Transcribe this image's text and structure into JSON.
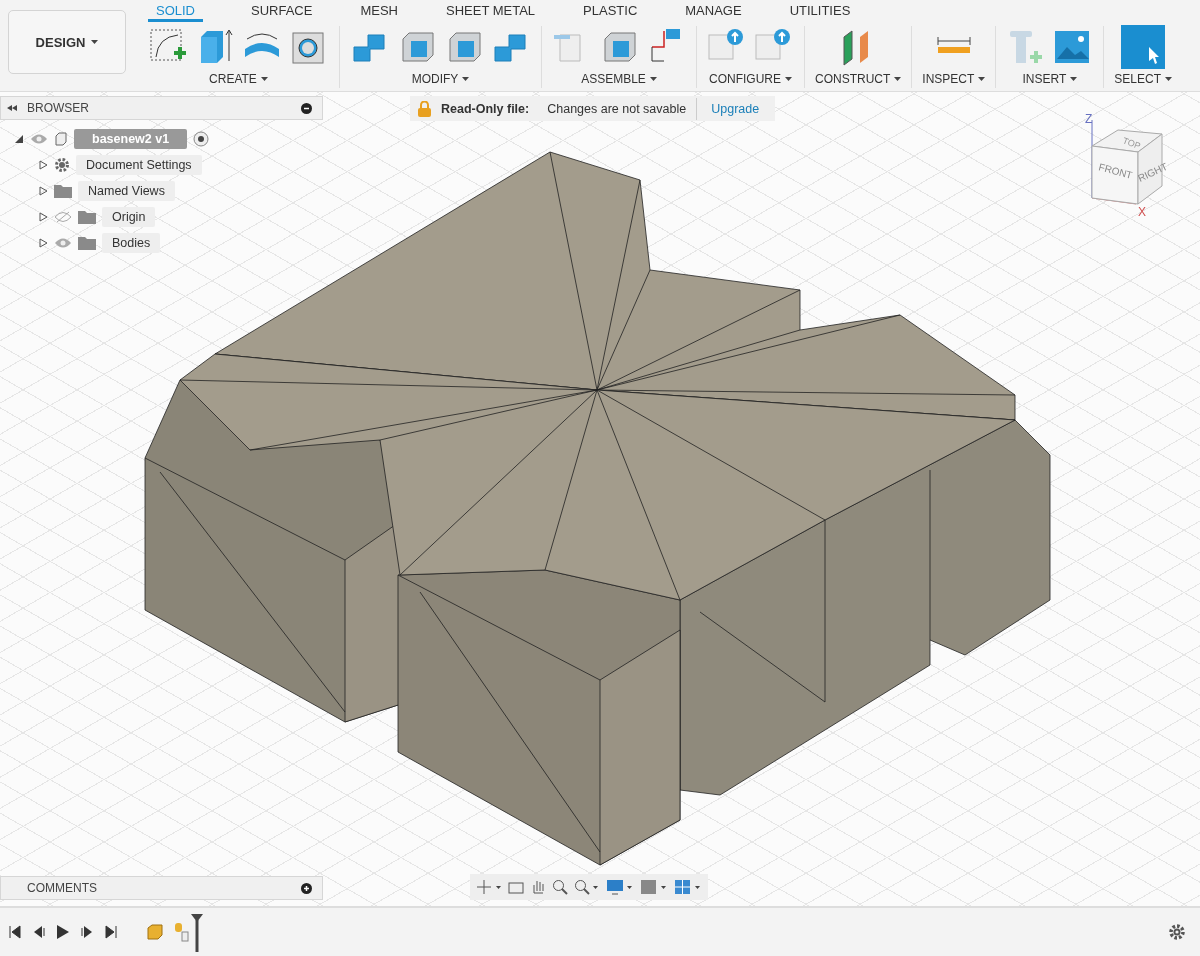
{
  "toolbar": {
    "workspace": "DESIGN",
    "tabs": [
      {
        "label": "SOLID",
        "selected": true
      },
      {
        "label": "SURFACE",
        "selected": false
      },
      {
        "label": "MESH",
        "selected": false
      },
      {
        "label": "SHEET METAL",
        "selected": false
      },
      {
        "label": "PLASTIC",
        "selected": false
      },
      {
        "label": "MANAGE",
        "selected": false
      },
      {
        "label": "UTILITIES",
        "selected": false
      }
    ],
    "groups": [
      {
        "label": "CREATE"
      },
      {
        "label": "MODIFY"
      },
      {
        "label": "ASSEMBLE"
      },
      {
        "label": "CONFIGURE"
      },
      {
        "label": "CONSTRUCT"
      },
      {
        "label": "INSPECT"
      },
      {
        "label": "INSERT"
      },
      {
        "label": "SELECT"
      }
    ]
  },
  "browser": {
    "title": "BROWSER",
    "tree": [
      {
        "label": "basenew2 v1",
        "kind": "component",
        "selected": true,
        "expanded": true,
        "visible": true,
        "children": [
          {
            "label": "Document Settings",
            "kind": "settings",
            "selected": false,
            "expanded": false
          },
          {
            "label": "Named Views",
            "kind": "folder",
            "selected": false,
            "expanded": false
          },
          {
            "label": "Origin",
            "kind": "folder",
            "selected": false,
            "expanded": false,
            "visible": false
          },
          {
            "label": "Bodies",
            "kind": "folder",
            "selected": false,
            "expanded": false,
            "visible": true
          }
        ]
      }
    ]
  },
  "banner": {
    "title": "Read-Only file:",
    "message": "Changes are not savable",
    "action": "Upgrade"
  },
  "viewcube": {
    "top": "TOP",
    "front": "FRONT",
    "right": "RIGHT",
    "z_axis": "Z",
    "x_axis": "X"
  },
  "comments": {
    "title": "COMMENTS"
  }
}
